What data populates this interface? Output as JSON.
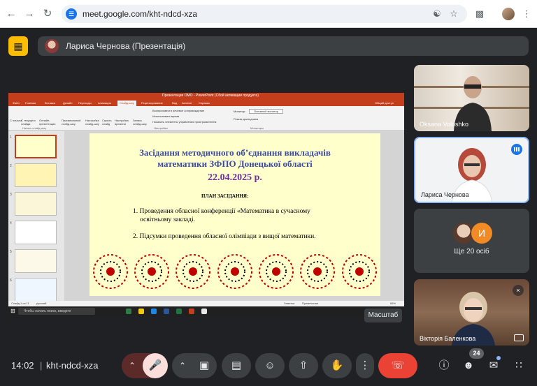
{
  "browser": {
    "url": "meet.google.com/kht-ndcd-xza"
  },
  "meet": {
    "presenter_label": "Лариса Чернова (Презентація)",
    "time": "14:02",
    "separator": "|",
    "meeting_code": "kht-ndcd-xza",
    "participants_count": "24",
    "tooltip": "Масштаб",
    "colors": {
      "end_call": "#ea4335",
      "accent": "#8ab4f8",
      "logo": "#fbbc04"
    }
  },
  "tiles": [
    {
      "name": "Oksana Voloshko"
    },
    {
      "name": "Лариса Чернова"
    },
    {
      "others_label": "Ще 20 осіб",
      "initial": "И"
    },
    {
      "name": "Вікторія Баленкова"
    }
  ],
  "powerpoint": {
    "window_title": "Презентация ОМО - PowerPoint (Сбой активации продукта)",
    "tabs": [
      "Файл",
      "Главная",
      "Вставка",
      "Дизайн",
      "Переходы",
      "Анимация",
      "Слайд-шоу",
      "Рецензирование",
      "Вид",
      "Acrobat",
      "Справка"
    ],
    "active_tab_index": 6,
    "share_label": "Общий доступ",
    "ribbon": {
      "from_start": "С начала",
      "from_current": "С текущего слайда",
      "online": "Онлайн-презентация",
      "custom": "Произвольный слайд-шоу",
      "setup": "Настройка слайд-шоу",
      "hide": "Скрыть слайд",
      "rehearse": "Настройка времени",
      "record": "Запись слайд-шоу",
      "cb1": "Воспроизвести речевое сопровождение",
      "cb2": "Использовать время",
      "cb3": "Показать элементы управления проигрывателем",
      "monitor_label": "Монитор:",
      "monitor_value": "Основной монитор",
      "presenter_view": "Режим докладчика",
      "group_start": "Начать слайд-шоу",
      "group_setup": "Настройка",
      "group_monitors": "Мониторы"
    },
    "status_left": "Слайд 1 из 11",
    "status_lang": "русский",
    "status_notes": "Заметки",
    "status_comments": "Примечания",
    "zoom": "65%",
    "taskbar_search": "Чтобы начать поиск, введите"
  },
  "slide": {
    "title_line1": "Засідання методичного об’єднання викладачів",
    "title_line2": "математики ЗФПО Донецької області",
    "date": "22.04.2025 р.",
    "plan_heading": "ПЛАН ЗАСІДАННЯ:",
    "item1_line1": "1. Проведення обласної конференції «Математика в сучасному",
    "item1_line2": "освітньому закладі.",
    "item2": "2. Підсумки проведення обласної олімпіади з вищої математики."
  }
}
